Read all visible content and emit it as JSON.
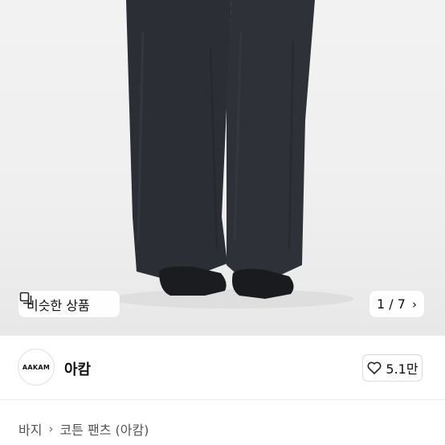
{
  "hero": {
    "similar_products_label": "비슷한 상품",
    "image_counter": "1 / 7"
  },
  "seller": {
    "logo_text": "AAKAM",
    "name": "아캄",
    "like_count": "5.1만"
  },
  "breadcrumb": {
    "items": [
      "바지",
      "코튼 팬츠 (아캄)"
    ]
  },
  "colors": {
    "pants": "#2b2e35",
    "background": "#f0f0f0"
  }
}
